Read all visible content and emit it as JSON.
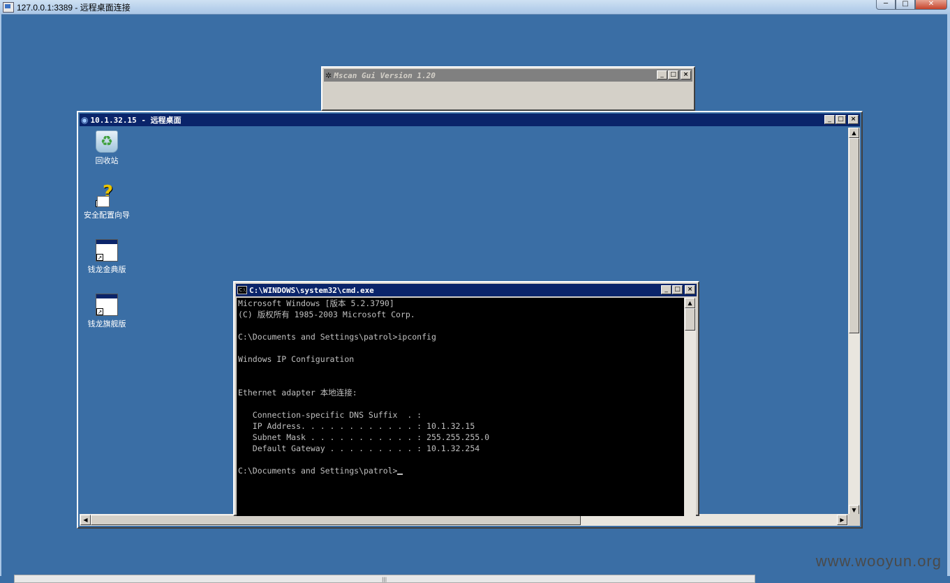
{
  "outer_window": {
    "title": "127.0.0.1:3389 - 远程桌面连接",
    "min_label": "─",
    "max_label": "□",
    "close_label": "✕"
  },
  "mscan_window": {
    "title": "Mscan Gui Version 1.20"
  },
  "rdp_window": {
    "title": "10.1.32.15 - 远程桌面"
  },
  "window_buttons": {
    "min": "_",
    "max": "□",
    "close": "×"
  },
  "desktop_icons": [
    {
      "label": "回收站",
      "icon": "recycle-bin-icon"
    },
    {
      "label": "安全配置向导",
      "icon": "security-wizard-icon"
    },
    {
      "label": "钱龙金典版",
      "icon": "app-shortcut-icon"
    },
    {
      "label": "钱龙旗舰版",
      "icon": "app-shortcut-icon"
    }
  ],
  "cmd_window": {
    "title": "C:\\WINDOWS\\system32\\cmd.exe",
    "icon_text": "C:\\",
    "lines": [
      "Microsoft Windows [版本 5.2.3790]",
      "(C) 版权所有 1985-2003 Microsoft Corp.",
      "",
      "C:\\Documents and Settings\\patrol>ipconfig",
      "",
      "Windows IP Configuration",
      "",
      "",
      "Ethernet adapter 本地连接:",
      "",
      "   Connection-specific DNS Suffix  . :",
      "   IP Address. . . . . . . . . . . . : 10.1.32.15",
      "   Subnet Mask . . . . . . . . . . . : 255.255.255.0",
      "   Default Gateway . . . . . . . . . : 10.1.32.254",
      "",
      "C:\\Documents and Settings\\patrol>"
    ]
  },
  "scroll_arrows": {
    "up": "▲",
    "down": "▼",
    "left": "◀",
    "right": "▶"
  },
  "bottom_grip": "|||",
  "watermark": "www.wooyun.org"
}
